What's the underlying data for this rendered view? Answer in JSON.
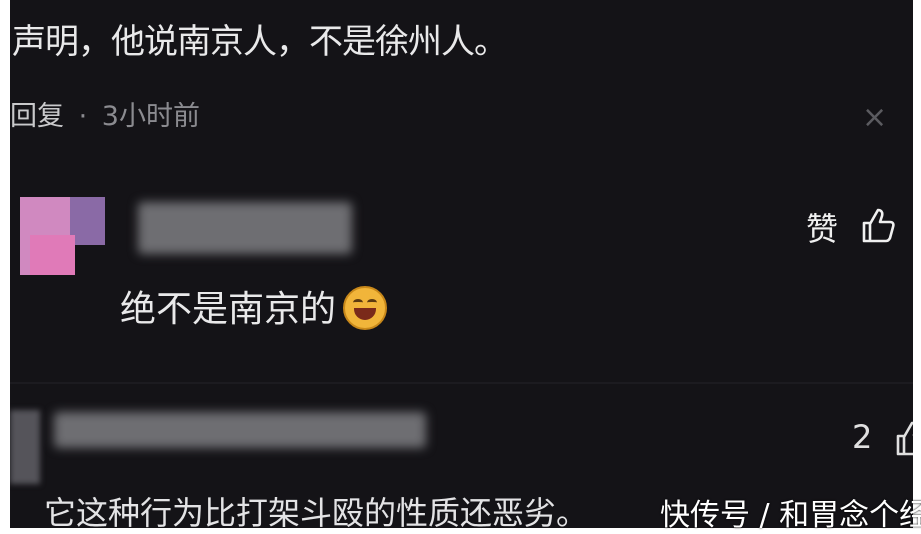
{
  "top_comment": {
    "text": "声明，他说南京人，不是徐州人。"
  },
  "reply_row": {
    "reply_label": "回复",
    "separator": "·",
    "time": "3小时前",
    "close_glyph": "×"
  },
  "comment1": {
    "like_label": "赞",
    "text": "绝不是南京的",
    "emoji": "laughing-emoji"
  },
  "comment2": {
    "like_count": "2",
    "text": "它这种行为比打架斗殴的性质还恶劣。"
  },
  "watermark": {
    "text": "快传号 / 和胃念个经"
  },
  "colors": {
    "background": "#141317",
    "text": "#e9e9ea",
    "muted": "#8b8b90"
  }
}
